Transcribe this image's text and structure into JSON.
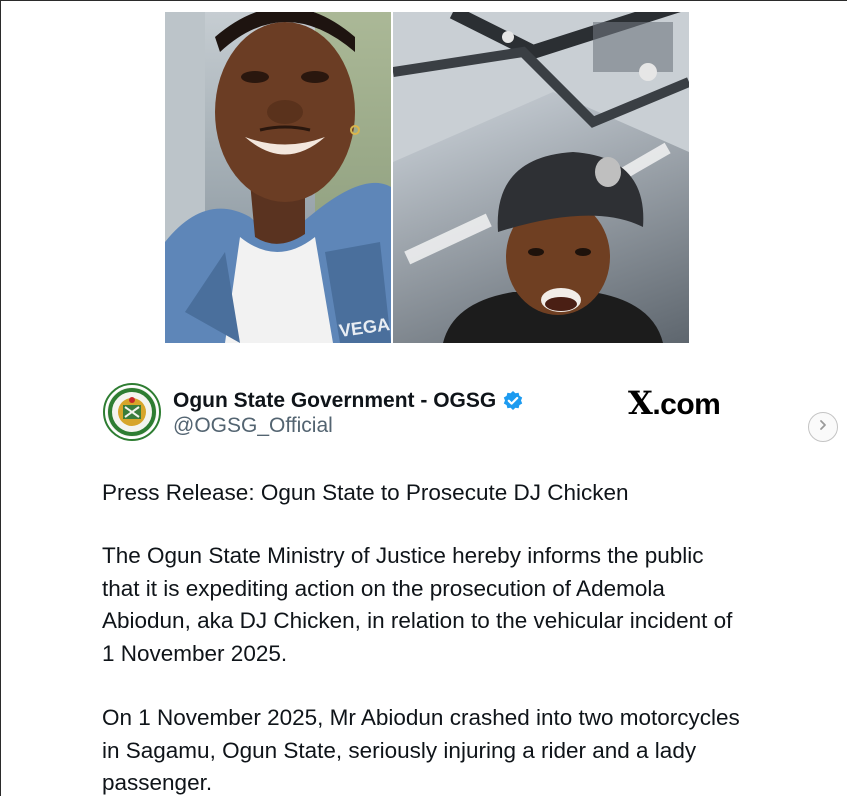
{
  "account": {
    "name": "Ogun State Government - OGSG",
    "handle": "@OGSG_Official",
    "verified_color": "#1d9bf0"
  },
  "brand": {
    "x_letter": "X",
    "suffix": ".com"
  },
  "icons": {
    "next": "chevron-right-icon",
    "verified": "verified-badge-icon",
    "logo": "ogun-state-seal-icon"
  },
  "post": {
    "headline": "Press Release: Ogun State to Prosecute DJ Chicken",
    "paragraph1": "The Ogun State Ministry of Justice hereby informs the public that it is expediting action on the prosecution of Ademola Abiodun, aka DJ Chicken, in relation to the vehicular incident of 1 November 2025.",
    "paragraph2": "On 1 November 2025, Mr Abiodun crashed into two motorcycles in Sagamu, Ogun State, seriously injuring a rider and a lady passenger."
  },
  "photos": {
    "left_text": "VEGA"
  }
}
